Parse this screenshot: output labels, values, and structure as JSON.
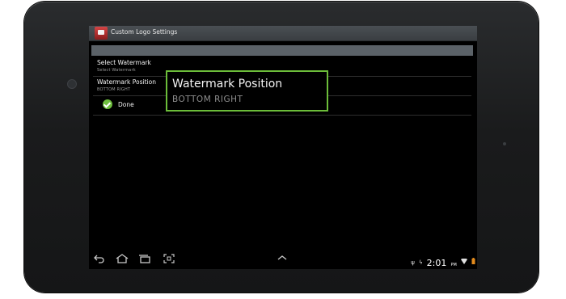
{
  "window": {
    "title": "Custom Logo Settings"
  },
  "settings": {
    "rows": [
      {
        "title": "Select Watermark",
        "subtitle": "Select Watermark"
      },
      {
        "title": "Watermark Position",
        "subtitle": "BOTTOM RIGHT"
      }
    ],
    "done_label": "Done"
  },
  "callout": {
    "title": "Watermark Position",
    "value": "BOTTOM RIGHT"
  },
  "statusbar": {
    "time": "2:01",
    "ampm": "PM"
  },
  "colors": {
    "highlight": "#6cbd3a",
    "done_check": "#6fbf3e",
    "titlebar": "#3e4347",
    "screen_bg": "#000000"
  },
  "icons": {
    "back": "back-icon",
    "home": "home-icon",
    "recent": "recent-apps-icon",
    "screenshot": "screenshot-icon",
    "up": "chevron-up-icon",
    "usb": "usb-icon",
    "wifi": "wifi-icon",
    "battery": "battery-icon"
  }
}
